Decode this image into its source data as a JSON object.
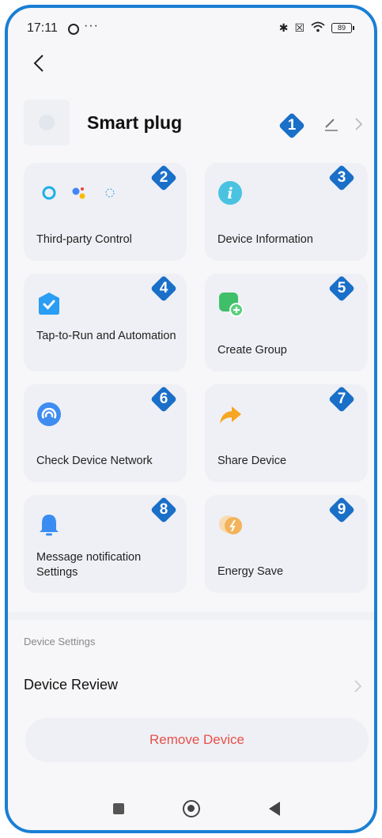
{
  "status_bar": {
    "time": "17:11",
    "dots": "···",
    "battery": "89"
  },
  "header": {
    "device_name": "Smart plug",
    "badge": "1"
  },
  "cards": [
    {
      "label": "Third-party Control",
      "badge": "2",
      "icon": "alexa-google-smartthings-icons"
    },
    {
      "label": "Device Information",
      "badge": "3",
      "icon": "info-icon"
    },
    {
      "label": "Tap-to-Run and Automation",
      "badge": "4",
      "icon": "automation-check-icon"
    },
    {
      "label": "Create Group",
      "badge": "5",
      "icon": "create-group-icon"
    },
    {
      "label": "Check Device Network",
      "badge": "6",
      "icon": "network-icon"
    },
    {
      "label": "Share Device",
      "badge": "7",
      "icon": "share-arrow-icon"
    },
    {
      "label": "Message notification Settings",
      "badge": "8",
      "icon": "bell-icon"
    },
    {
      "label": "Energy Save",
      "badge": "9",
      "icon": "energy-icon"
    }
  ],
  "settings": {
    "section_label": "Device Settings",
    "review_label": "Device Review"
  },
  "remove_button": "Remove Device",
  "colors": {
    "badge": "#1a6fc8",
    "frame": "#1a7fd4",
    "remove_text": "#e8504a",
    "card_bg": "#eef0f5"
  }
}
